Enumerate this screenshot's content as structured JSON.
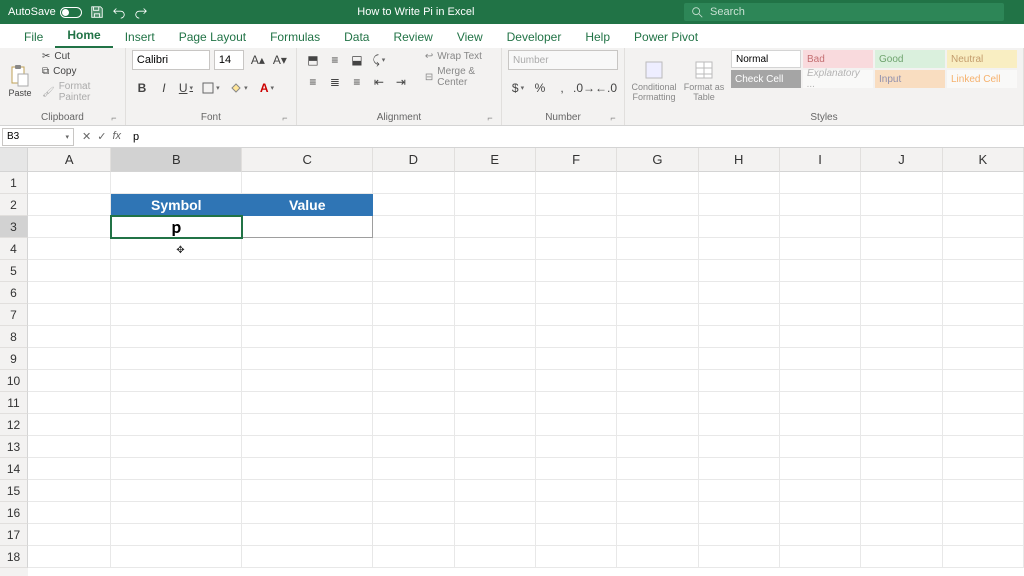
{
  "titlebar": {
    "autosave_label": "AutoSave",
    "autosave_state": "Off",
    "doc_title": "How to Write Pi in Excel",
    "search_placeholder": "Search"
  },
  "tabs": {
    "file": "File",
    "home": "Home",
    "insert": "Insert",
    "page_layout": "Page Layout",
    "formulas": "Formulas",
    "data": "Data",
    "review": "Review",
    "view": "View",
    "developer": "Developer",
    "help": "Help",
    "power_pivot": "Power Pivot"
  },
  "ribbon": {
    "clipboard": {
      "paste": "Paste",
      "cut": "Cut",
      "copy": "Copy",
      "format_painter": "Format Painter",
      "label": "Clipboard"
    },
    "font": {
      "name": "Calibri",
      "size": "14",
      "label": "Font"
    },
    "alignment": {
      "wrap": "Wrap Text",
      "merge": "Merge & Center",
      "label": "Alignment"
    },
    "number": {
      "format": "Number",
      "label": "Number"
    },
    "styles": {
      "cond_fmt": "Conditional Formatting",
      "fmt_table": "Format as Table",
      "normal": "Normal",
      "bad": "Bad",
      "good": "Good",
      "neutral": "Neutral",
      "check": "Check Cell",
      "explanatory": "Explanatory ...",
      "input": "Input",
      "linked": "Linked Cell",
      "label": "Styles"
    }
  },
  "formula_bar": {
    "name_box": "B3",
    "formula": "p"
  },
  "grid": {
    "columns": [
      "A",
      "B",
      "C",
      "D",
      "E",
      "F",
      "G",
      "H",
      "I",
      "J",
      "K"
    ],
    "rows": [
      "1",
      "2",
      "3",
      "4",
      "5",
      "6",
      "7",
      "8",
      "9",
      "10",
      "11",
      "12",
      "13",
      "14",
      "15",
      "16",
      "17",
      "18"
    ],
    "selected_cell": "B3",
    "header_b2": "Symbol",
    "header_c2": "Value",
    "value_b3": "p"
  }
}
